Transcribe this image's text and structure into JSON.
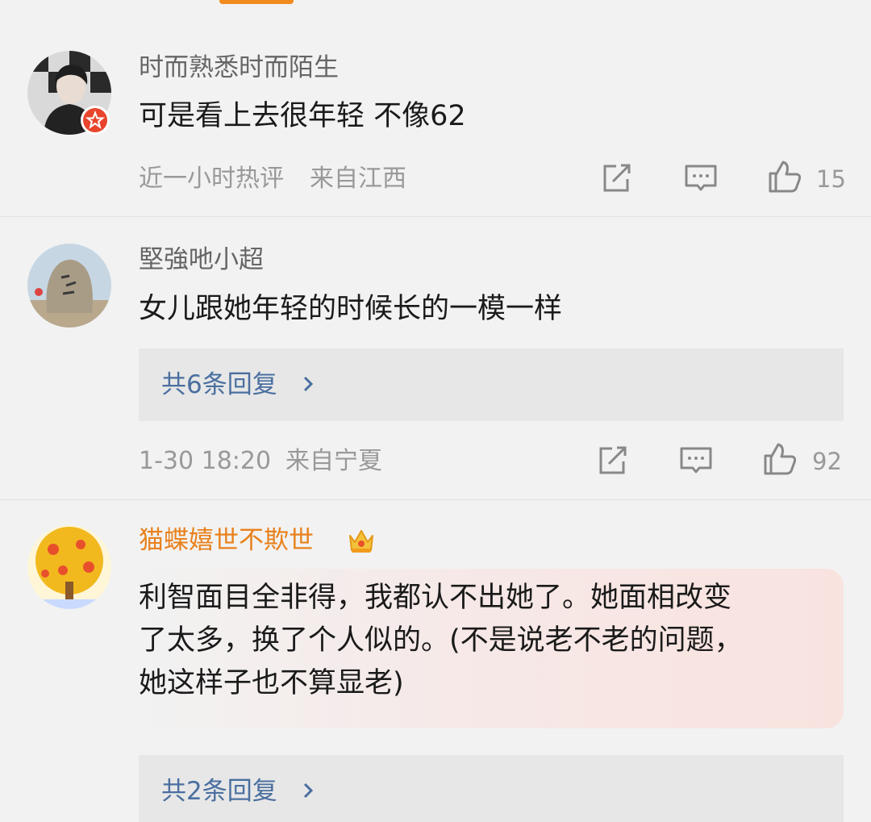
{
  "comments": [
    {
      "username": "时而熟悉时而陌生",
      "text": "可是看上去很年轻 不像62",
      "time": "近一小时热评",
      "location": "来自江西",
      "likes": "15"
    },
    {
      "username": "堅強吔小超",
      "text": "女儿跟她年轻的时候长的一模一样",
      "replies": "共6条回复",
      "time": "1-30 18:20",
      "location": "来自宁夏",
      "likes": "92"
    },
    {
      "username": "猫蝶嬉世不欺世",
      "text_lines": [
        "利智面目全非得，我都认不出她了。她面相改变",
        "了太多，换了个人似的。(不是说老不老的问题，",
        "她这样子也不算显老)"
      ],
      "replies": "共2条回复"
    }
  ],
  "colors": {
    "accent": "#f28b1d",
    "vip_name": "#e8811c",
    "reply_link": "#4a6fa0",
    "meta": "#999999"
  },
  "icons": [
    "share-icon",
    "comment-icon",
    "like-icon",
    "chevron-right-icon",
    "crown-icon",
    "star-badge-icon"
  ]
}
